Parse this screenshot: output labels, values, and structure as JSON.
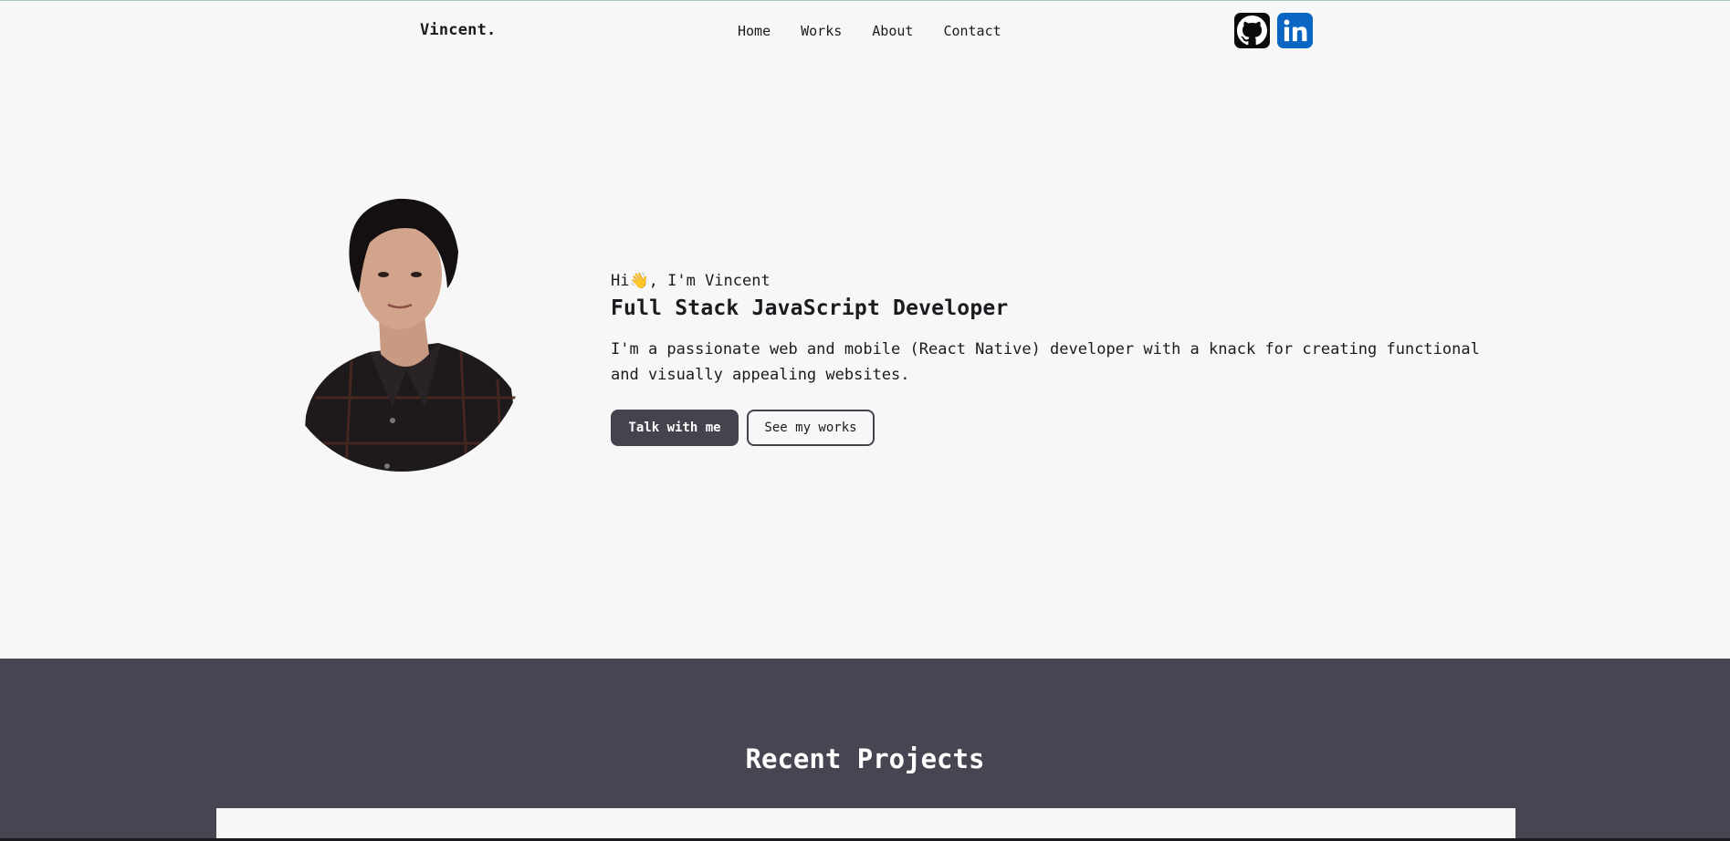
{
  "navbar": {
    "brand": "Vincent.",
    "links": [
      {
        "label": "Home"
      },
      {
        "label": "Works"
      },
      {
        "label": "About"
      },
      {
        "label": "Contact"
      }
    ],
    "socials": [
      {
        "icon": "github-icon",
        "color": "#0b0b0b"
      },
      {
        "icon": "linkedin-icon",
        "color": "#0a66c2"
      }
    ]
  },
  "hero": {
    "greeting_prefix": "Hi",
    "greeting_emoji": "👋",
    "greeting_suffix": ", I'm Vincent",
    "title": "Full Stack JavaScript Developer",
    "description": "I'm a passionate web and mobile (React Native) developer with a knack for creating functional and visually appealing websites.",
    "primary_button": "Talk with me",
    "secondary_button": "See my works"
  },
  "projects": {
    "title": "Recent Projects",
    "background_color": "#484452"
  },
  "colors": {
    "page_background": "#f7f7f7",
    "accent_dark": "#46434f",
    "text": "#1b1b1f"
  }
}
